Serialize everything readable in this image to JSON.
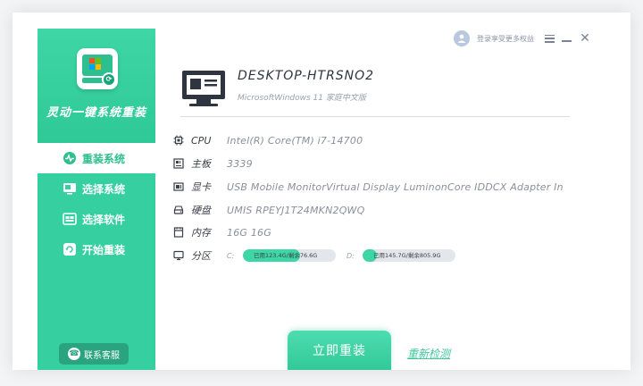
{
  "app": {
    "title": "灵动一键系统重装",
    "support_label": "联系客服"
  },
  "topbar": {
    "login_text": "登录享受更多权益"
  },
  "nav": {
    "items": [
      {
        "label": "重装系统",
        "icon": "pulse-icon",
        "active": true
      },
      {
        "label": "选择系统",
        "icon": "monitor-icon",
        "active": false
      },
      {
        "label": "选择软件",
        "icon": "apps-icon",
        "active": false
      },
      {
        "label": "开始重装",
        "icon": "refresh-icon",
        "active": false
      }
    ]
  },
  "device": {
    "name": "DESKTOP-HTRSNO2",
    "os": "MicrosoftWindows 11 家庭中文版"
  },
  "specs": {
    "cpu": {
      "label": "CPU",
      "value": "Intel(R) Core(TM) i7-14700"
    },
    "board": {
      "label": "主板",
      "value": "3339"
    },
    "gpu": {
      "label": "显卡",
      "value": "USB Mobile MonitorVirtual Display LuminonCore IDDCX Adapter In"
    },
    "disk": {
      "label": "硬盘",
      "value": "UMIS RPEYJ1T24MKN2QWQ"
    },
    "memory": {
      "label": "内存",
      "value": "16G 16G"
    },
    "partition": {
      "label": "分区"
    }
  },
  "partitions": [
    {
      "letter": "C:",
      "text": "已用123.4G/剩余76.6G",
      "used_fraction": 0.62
    },
    {
      "letter": "D:",
      "text": "已用145.7G/剩余805.9G",
      "used_fraction": 0.15
    }
  ],
  "actions": {
    "reinstall": "立即重装",
    "recheck": "重新检测"
  },
  "colors": {
    "accent": "#36d0a0",
    "accent_dark": "#2aa37f",
    "text_dark": "#2e3440",
    "text_muted": "#8a909b"
  }
}
